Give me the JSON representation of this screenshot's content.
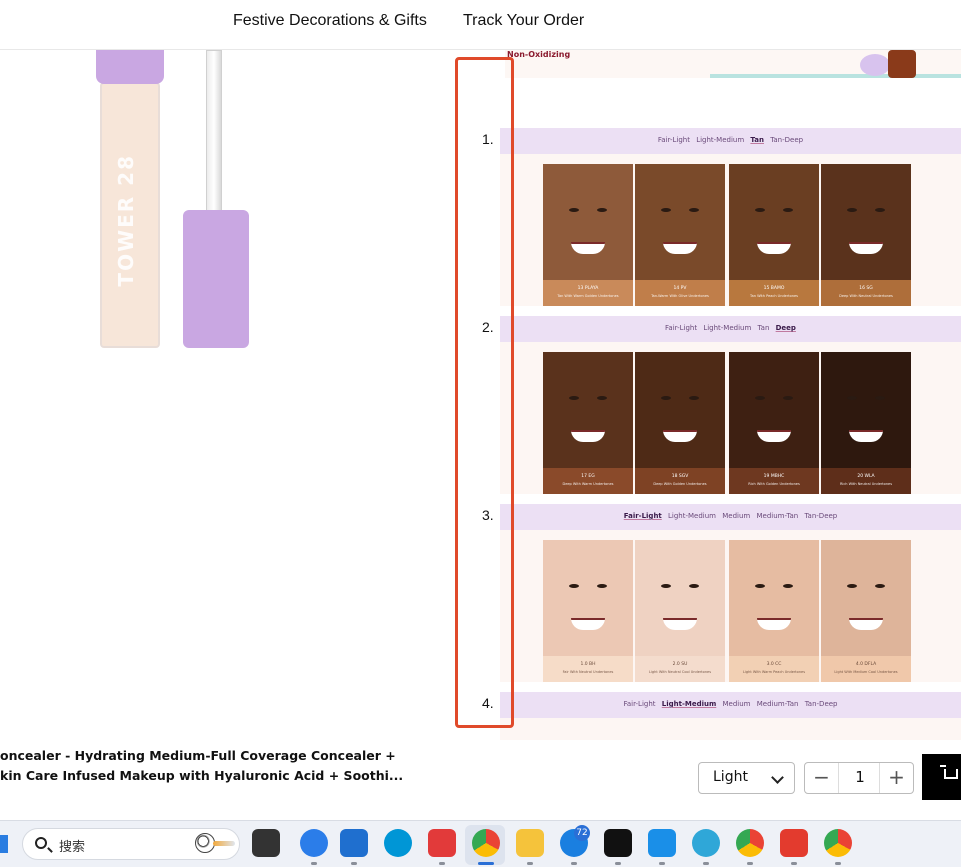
{
  "nav": {
    "item1": "Festive Decorations & Gifts",
    "item2": "Track Your Order"
  },
  "product_image": {
    "brand_text": "TOWER 28"
  },
  "right_panel": {
    "banner_text": "Non-Oxidizing",
    "sections": [
      {
        "number": "1.",
        "tabs": [
          "Fair-Light",
          "Light-Medium",
          "Tan",
          "Tan-Deep"
        ],
        "active": "Tan",
        "faces": [
          {
            "shade": "13 PLAYA",
            "desc": "Tan With Warm Golden Undertones",
            "skin": "#8e5a3a",
            "label_bg": "#c98a5a"
          },
          {
            "shade": "14 PV",
            "desc": "Tan-Warm With Olive Undertones",
            "skin": "#7a4a2a",
            "label_bg": "#c07e4a"
          },
          {
            "shade": "15 BAMO",
            "desc": "Tan With Peach Undertones",
            "skin": "#6a3e22",
            "label_bg": "#b8783e"
          },
          {
            "shade": "16 SG",
            "desc": "Deep With Neutral Undertones",
            "skin": "#5a321c",
            "label_bg": "#ae6e3a"
          }
        ]
      },
      {
        "number": "2.",
        "tabs": [
          "Fair-Light",
          "Light-Medium",
          "Tan",
          "Deep"
        ],
        "active": "Deep",
        "faces": [
          {
            "shade": "17 EG",
            "desc": "Deep With Warm Undertones",
            "skin": "#5a321c",
            "label_bg": "#8a4a2a"
          },
          {
            "shade": "18 SGV",
            "desc": "Deep With Golden Undertones",
            "skin": "#4e2a16",
            "label_bg": "#7e4224"
          },
          {
            "shade": "19 MBHC",
            "desc": "Rich With Golden Undertones",
            "skin": "#3e2012",
            "label_bg": "#6e3820"
          },
          {
            "shade": "20 WLA",
            "desc": "Rich With Neutral Undertones",
            "skin": "#2e180e",
            "label_bg": "#5e2e1a"
          }
        ]
      },
      {
        "number": "3.",
        "tabs": [
          "Fair-Light",
          "Light-Medium",
          "Medium",
          "Medium-Tan",
          "Tan-Deep"
        ],
        "active": "Fair-Light",
        "faces": [
          {
            "shade": "1.0 BH",
            "desc": "Fair With Neutral Undertones",
            "skin": "#ecc8b4",
            "label_bg": "#f6dcc8"
          },
          {
            "shade": "2.0 SU",
            "desc": "Light With Neutral Cool Undertones",
            "skin": "#efd2c2",
            "label_bg": "#f4dccd"
          },
          {
            "shade": "3.0 CC",
            "desc": "Light With Warm Peach Undertones",
            "skin": "#e6bca2",
            "label_bg": "#f2d0b4"
          },
          {
            "shade": "4.0 DFLA",
            "desc": "Light With Medium Cool Undertones",
            "skin": "#deb49a",
            "label_bg": "#f0c8aa"
          }
        ]
      },
      {
        "number": "4.",
        "tabs": [
          "Fair-Light",
          "Light-Medium",
          "Medium",
          "Medium-Tan",
          "Tan-Deep"
        ],
        "active": "Light-Medium"
      }
    ]
  },
  "buybar": {
    "title_line1": "oncealer - Hydrating Medium-Full Coverage Concealer +",
    "title_line2": "kin Care Infused Makeup with Hyaluronic Acid + Soothi...",
    "shade_value": "Light",
    "qty_minus": "−",
    "qty_value": "1",
    "qty_plus": "+"
  },
  "taskbar": {
    "search_text": "搜索",
    "badge_count": "72"
  }
}
